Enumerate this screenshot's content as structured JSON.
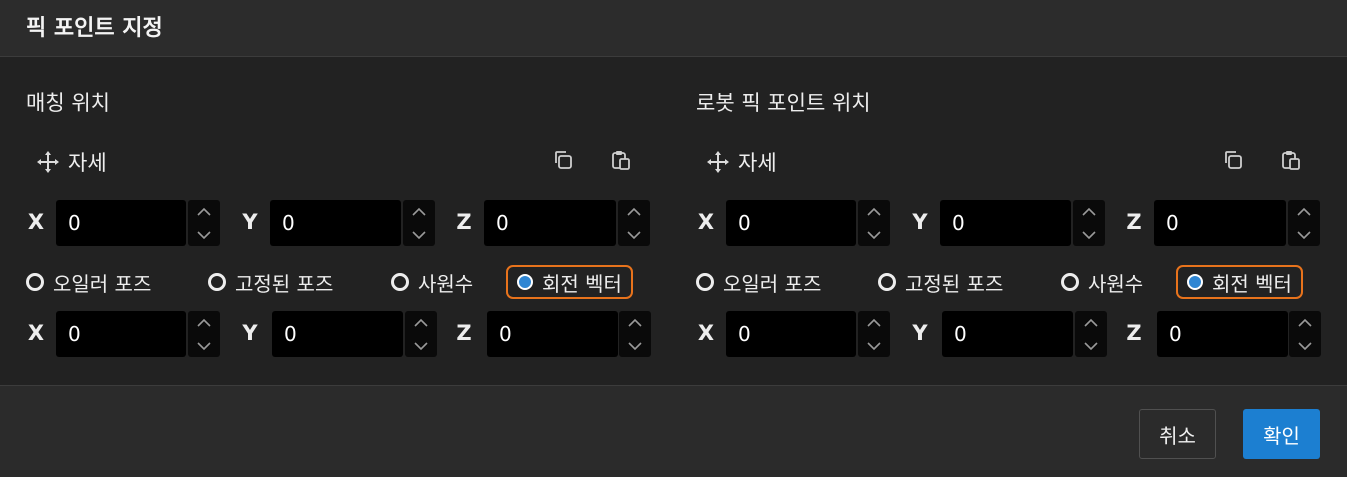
{
  "dialog": {
    "title": "픽 포인트 지정"
  },
  "panels": [
    {
      "section_title": "매칭 위치",
      "pose_label": "자세",
      "position": {
        "x_label": "X",
        "x": "0",
        "y_label": "Y",
        "y": "0",
        "z_label": "Z",
        "z": "0"
      },
      "rotation_modes": [
        "오일러 포즈",
        "고정된 포즈",
        "사원수",
        "회전 벡터"
      ],
      "selected_mode": "회전 벡터",
      "rotation": {
        "x_label": "X",
        "x": "0",
        "y_label": "Y",
        "y": "0",
        "z_label": "Z",
        "z": "0"
      }
    },
    {
      "section_title": "로봇 픽 포인트 위치",
      "pose_label": "자세",
      "position": {
        "x_label": "X",
        "x": "0",
        "y_label": "Y",
        "y": "0",
        "z_label": "Z",
        "z": "0"
      },
      "rotation_modes": [
        "오일러 포즈",
        "고정된 포즈",
        "사원수",
        "회전 벡터"
      ],
      "selected_mode": "회전 벡터",
      "rotation": {
        "x_label": "X",
        "x": "0",
        "y_label": "Y",
        "y": "0",
        "z_label": "Z",
        "z": "0"
      }
    }
  ],
  "footer": {
    "cancel_label": "취소",
    "ok_label": "확인"
  },
  "icons": {
    "pose": "move-icon",
    "copy": "copy-icon",
    "paste": "paste-icon",
    "spin_up": "chevron-up-icon",
    "spin_down": "chevron-down-icon"
  },
  "colors": {
    "accent": "#1c7fd1",
    "selection_outline": "#e8731c",
    "radio_fill": "#2f86d3",
    "background": "#222222"
  }
}
